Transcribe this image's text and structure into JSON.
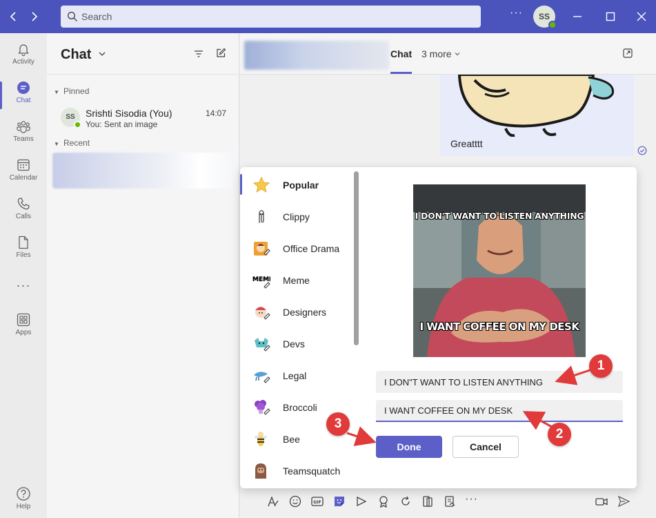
{
  "titlebar": {
    "search_placeholder": "Search",
    "avatar_initials": "SS",
    "more_label": "···"
  },
  "rail": {
    "items": [
      {
        "label": "Activity",
        "icon": "bell-icon"
      },
      {
        "label": "Chat",
        "icon": "chat-icon",
        "active": true
      },
      {
        "label": "Teams",
        "icon": "teams-icon"
      },
      {
        "label": "Calendar",
        "icon": "calendar-icon"
      },
      {
        "label": "Calls",
        "icon": "phone-icon"
      },
      {
        "label": "Files",
        "icon": "file-icon"
      }
    ],
    "more_label": "···",
    "apps_label": "Apps",
    "help_label": "Help"
  },
  "chatlist": {
    "title": "Chat",
    "pinned_label": "Pinned",
    "recent_label": "Recent",
    "pinned": [
      {
        "initials": "SS",
        "name": "Srishti Sisodia (You)",
        "preview": "You: Sent an image",
        "time": "14:07"
      }
    ]
  },
  "conversation": {
    "tab_active": "Chat",
    "tab_more": "3 more",
    "last_message": "Greatttt"
  },
  "sticker_picker": {
    "categories": [
      {
        "label": "Popular",
        "icon": "star-icon",
        "active": true
      },
      {
        "label": "Clippy",
        "icon": "paperclip-icon"
      },
      {
        "label": "Office Drama",
        "icon": "office-drama-icon"
      },
      {
        "label": "Meme",
        "icon": "meme-icon"
      },
      {
        "label": "Designers",
        "icon": "designers-icon"
      },
      {
        "label": "Devs",
        "icon": "devs-icon"
      },
      {
        "label": "Legal",
        "icon": "legal-icon"
      },
      {
        "label": "Broccoli",
        "icon": "broccoli-icon"
      },
      {
        "label": "Bee",
        "icon": "bee-icon"
      },
      {
        "label": "Teamsquatch",
        "icon": "teamsquatch-icon"
      }
    ],
    "meme_top_text": "I DON'T WANT TO LISTEN ANYTHING",
    "meme_bottom_text": "I WANT COFFEE ON MY DESK",
    "top_text_value": "I DON\"T WANT TO LISTEN ANYTHING",
    "bottom_text_value": "I WANT COFFEE ON MY DESK",
    "done_label": "Done",
    "cancel_label": "Cancel"
  },
  "callouts": [
    "1",
    "2",
    "3"
  ],
  "colors": {
    "brand": "#4b53bc",
    "accent": "#5b5fc7",
    "callout": "#e03a3a"
  }
}
